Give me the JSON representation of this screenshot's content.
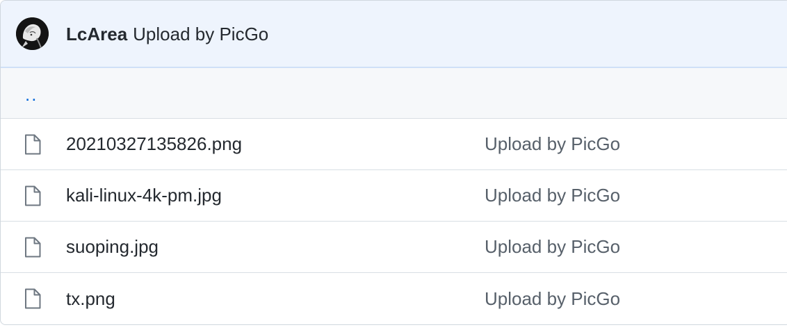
{
  "commit": {
    "author": "LcArea",
    "message": "Upload by PicGo",
    "avatar_icon": "user-avatar"
  },
  "parent": {
    "label": ".."
  },
  "files": [
    {
      "name": "20210327135826.png",
      "commit_message": "Upload by PicGo",
      "icon": "file-icon"
    },
    {
      "name": "kali-linux-4k-pm.jpg",
      "commit_message": "Upload by PicGo",
      "icon": "file-icon"
    },
    {
      "name": "suoping.jpg",
      "commit_message": "Upload by PicGo",
      "icon": "file-icon"
    },
    {
      "name": "tx.png",
      "commit_message": "Upload by PicGo",
      "icon": "file-icon"
    }
  ],
  "colors": {
    "header_bg": "#eef4fd",
    "link": "#0969da",
    "muted_text": "#57606a",
    "border": "#d0d7de"
  }
}
